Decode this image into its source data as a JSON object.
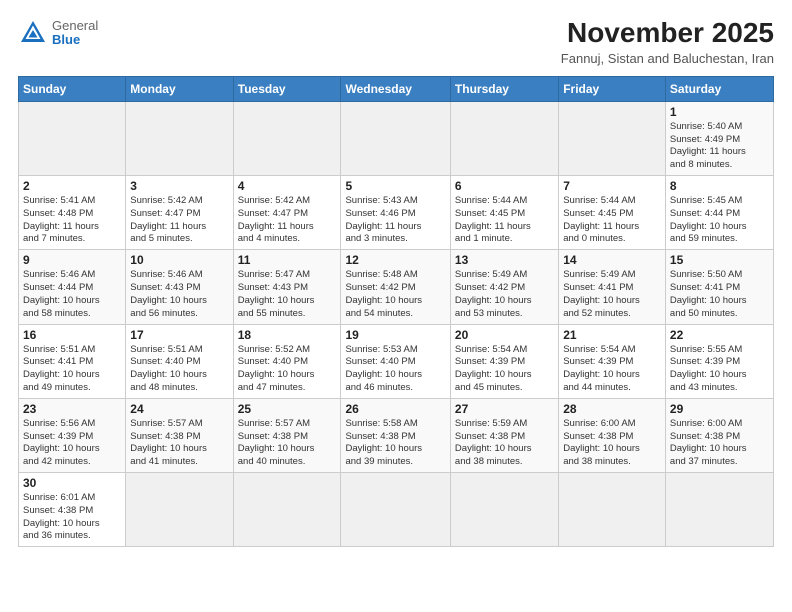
{
  "header": {
    "logo_general": "General",
    "logo_blue": "Blue",
    "month_title": "November 2025",
    "subtitle": "Fannuj, Sistan and Baluchestan, Iran"
  },
  "weekdays": [
    "Sunday",
    "Monday",
    "Tuesday",
    "Wednesday",
    "Thursday",
    "Friday",
    "Saturday"
  ],
  "weeks": [
    [
      {
        "day": "",
        "info": ""
      },
      {
        "day": "",
        "info": ""
      },
      {
        "day": "",
        "info": ""
      },
      {
        "day": "",
        "info": ""
      },
      {
        "day": "",
        "info": ""
      },
      {
        "day": "",
        "info": ""
      },
      {
        "day": "1",
        "info": "Sunrise: 5:40 AM\nSunset: 4:49 PM\nDaylight: 11 hours\nand 8 minutes."
      }
    ],
    [
      {
        "day": "2",
        "info": "Sunrise: 5:41 AM\nSunset: 4:48 PM\nDaylight: 11 hours\nand 7 minutes."
      },
      {
        "day": "3",
        "info": "Sunrise: 5:42 AM\nSunset: 4:47 PM\nDaylight: 11 hours\nand 5 minutes."
      },
      {
        "day": "4",
        "info": "Sunrise: 5:42 AM\nSunset: 4:47 PM\nDaylight: 11 hours\nand 4 minutes."
      },
      {
        "day": "5",
        "info": "Sunrise: 5:43 AM\nSunset: 4:46 PM\nDaylight: 11 hours\nand 3 minutes."
      },
      {
        "day": "6",
        "info": "Sunrise: 5:44 AM\nSunset: 4:45 PM\nDaylight: 11 hours\nand 1 minute."
      },
      {
        "day": "7",
        "info": "Sunrise: 5:44 AM\nSunset: 4:45 PM\nDaylight: 11 hours\nand 0 minutes."
      },
      {
        "day": "8",
        "info": "Sunrise: 5:45 AM\nSunset: 4:44 PM\nDaylight: 10 hours\nand 59 minutes."
      }
    ],
    [
      {
        "day": "9",
        "info": "Sunrise: 5:46 AM\nSunset: 4:44 PM\nDaylight: 10 hours\nand 58 minutes."
      },
      {
        "day": "10",
        "info": "Sunrise: 5:46 AM\nSunset: 4:43 PM\nDaylight: 10 hours\nand 56 minutes."
      },
      {
        "day": "11",
        "info": "Sunrise: 5:47 AM\nSunset: 4:43 PM\nDaylight: 10 hours\nand 55 minutes."
      },
      {
        "day": "12",
        "info": "Sunrise: 5:48 AM\nSunset: 4:42 PM\nDaylight: 10 hours\nand 54 minutes."
      },
      {
        "day": "13",
        "info": "Sunrise: 5:49 AM\nSunset: 4:42 PM\nDaylight: 10 hours\nand 53 minutes."
      },
      {
        "day": "14",
        "info": "Sunrise: 5:49 AM\nSunset: 4:41 PM\nDaylight: 10 hours\nand 52 minutes."
      },
      {
        "day": "15",
        "info": "Sunrise: 5:50 AM\nSunset: 4:41 PM\nDaylight: 10 hours\nand 50 minutes."
      }
    ],
    [
      {
        "day": "16",
        "info": "Sunrise: 5:51 AM\nSunset: 4:41 PM\nDaylight: 10 hours\nand 49 minutes."
      },
      {
        "day": "17",
        "info": "Sunrise: 5:51 AM\nSunset: 4:40 PM\nDaylight: 10 hours\nand 48 minutes."
      },
      {
        "day": "18",
        "info": "Sunrise: 5:52 AM\nSunset: 4:40 PM\nDaylight: 10 hours\nand 47 minutes."
      },
      {
        "day": "19",
        "info": "Sunrise: 5:53 AM\nSunset: 4:40 PM\nDaylight: 10 hours\nand 46 minutes."
      },
      {
        "day": "20",
        "info": "Sunrise: 5:54 AM\nSunset: 4:39 PM\nDaylight: 10 hours\nand 45 minutes."
      },
      {
        "day": "21",
        "info": "Sunrise: 5:54 AM\nSunset: 4:39 PM\nDaylight: 10 hours\nand 44 minutes."
      },
      {
        "day": "22",
        "info": "Sunrise: 5:55 AM\nSunset: 4:39 PM\nDaylight: 10 hours\nand 43 minutes."
      }
    ],
    [
      {
        "day": "23",
        "info": "Sunrise: 5:56 AM\nSunset: 4:39 PM\nDaylight: 10 hours\nand 42 minutes."
      },
      {
        "day": "24",
        "info": "Sunrise: 5:57 AM\nSunset: 4:38 PM\nDaylight: 10 hours\nand 41 minutes."
      },
      {
        "day": "25",
        "info": "Sunrise: 5:57 AM\nSunset: 4:38 PM\nDaylight: 10 hours\nand 40 minutes."
      },
      {
        "day": "26",
        "info": "Sunrise: 5:58 AM\nSunset: 4:38 PM\nDaylight: 10 hours\nand 39 minutes."
      },
      {
        "day": "27",
        "info": "Sunrise: 5:59 AM\nSunset: 4:38 PM\nDaylight: 10 hours\nand 38 minutes."
      },
      {
        "day": "28",
        "info": "Sunrise: 6:00 AM\nSunset: 4:38 PM\nDaylight: 10 hours\nand 38 minutes."
      },
      {
        "day": "29",
        "info": "Sunrise: 6:00 AM\nSunset: 4:38 PM\nDaylight: 10 hours\nand 37 minutes."
      }
    ],
    [
      {
        "day": "30",
        "info": "Sunrise: 6:01 AM\nSunset: 4:38 PM\nDaylight: 10 hours\nand 36 minutes."
      },
      {
        "day": "",
        "info": ""
      },
      {
        "day": "",
        "info": ""
      },
      {
        "day": "",
        "info": ""
      },
      {
        "day": "",
        "info": ""
      },
      {
        "day": "",
        "info": ""
      },
      {
        "day": "",
        "info": ""
      }
    ]
  ]
}
